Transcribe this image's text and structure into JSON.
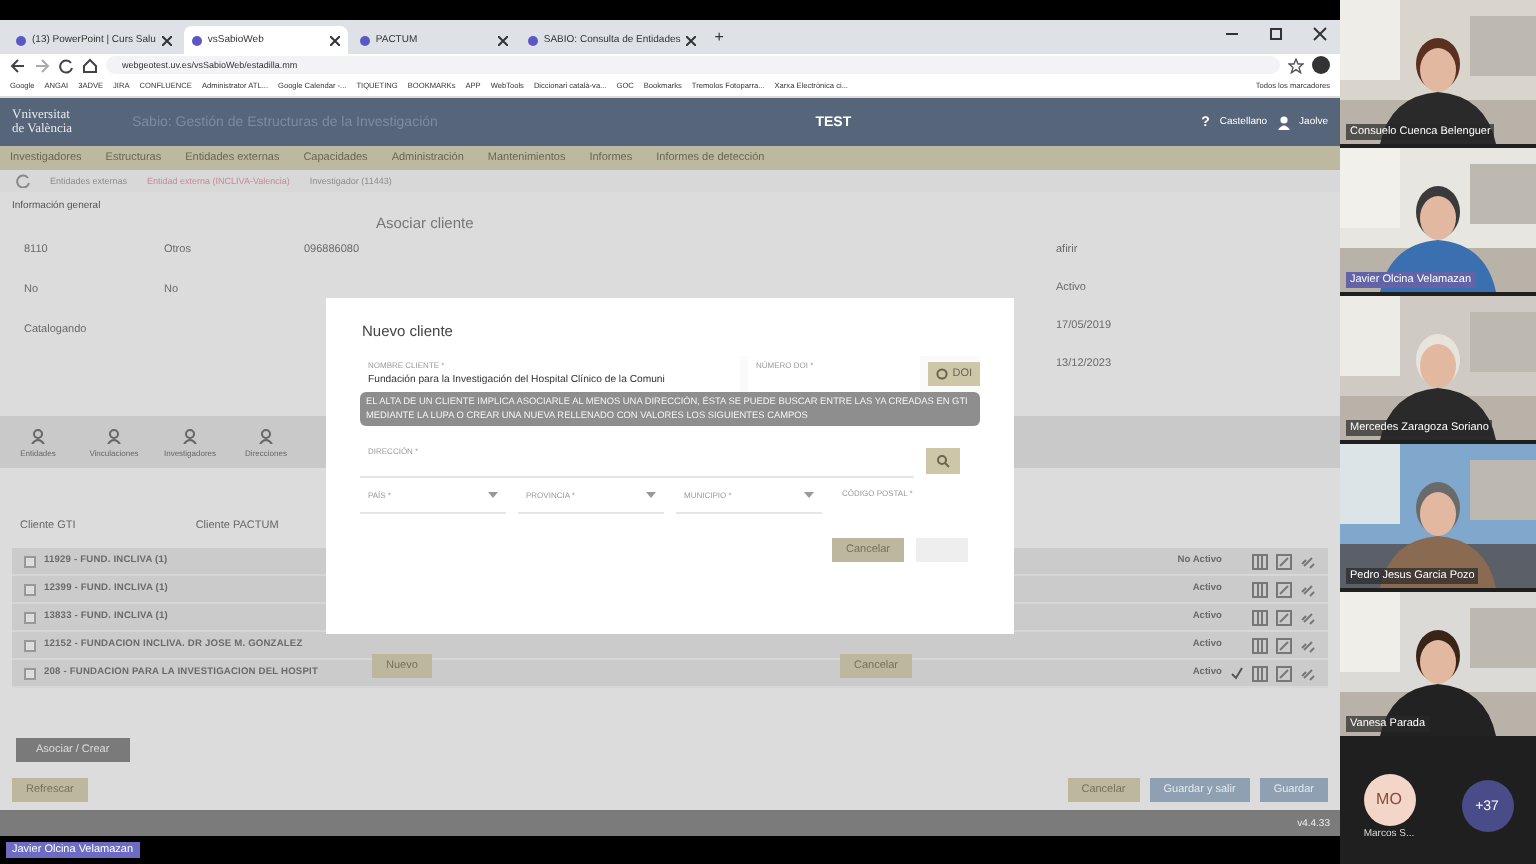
{
  "browser": {
    "tabs": [
      {
        "title": "(13) PowerPoint | Curs Salu",
        "selected": false
      },
      {
        "title": "vsSabioWeb",
        "selected": true
      },
      {
        "title": "PACTUM",
        "selected": false
      },
      {
        "title": "SABIO: Consulta de Entidades",
        "selected": false
      }
    ],
    "new_tab": "+",
    "url": "webgeotest.uv.es/vsSabioWeb/estadilla.mm",
    "bookmarks": [
      "Google",
      "ANGAI",
      "3ADVE",
      "JIRA",
      "CONFLUENCE",
      "Administrator ATL...",
      "Google Calendar -...",
      "TIQUETING",
      "BOOKMARKs",
      "APP",
      "WebTools",
      "Diccionari català-va...",
      "GOC",
      "Bookmarks",
      "Tremolos Fotoparra...",
      "Xarxa Electrònica ci..."
    ],
    "all_bookmarks": "Todos los marcadores"
  },
  "app": {
    "logo": [
      "Vniversitat",
      "de València"
    ],
    "subtitle": "Sabio: Gestión de Estructuras de la Investigación",
    "env": "TEST",
    "help": "?",
    "language": "Castellano",
    "user": "Jaolve",
    "menu": [
      "Investigadores",
      "Estructuras",
      "Entidades externas",
      "Capacidades",
      "Administración",
      "Mantenimientos",
      "Informes",
      "Informes de detección"
    ],
    "breadcrumbs": [
      "Entidades externas",
      "Entidad externa (INCLIVA-Valencia)",
      "Investigador (11443)"
    ]
  },
  "section_title": "Información general",
  "left_rows": [
    [
      "8110",
      "Otros",
      "096886080"
    ],
    [
      "No",
      "No"
    ],
    [
      "Catalogando"
    ]
  ],
  "right_values": [
    "afirir",
    "Activo",
    "17/05/2019",
    "13/12/2023"
  ],
  "detail_tabs": [
    "Entidades",
    "Vinculaciones",
    "Investigadores",
    "Direcciones"
  ],
  "table": {
    "columns": [
      "Cliente GTI",
      "Cliente PACTUM"
    ],
    "rows": [
      {
        "name": "11929 - FUND. INCLIVA (1)",
        "status": "No Activo",
        "verified": false,
        "checked": false
      },
      {
        "name": "12399 - FUND. INCLIVA (1)",
        "status": "Activo",
        "verified": false,
        "checked": false
      },
      {
        "name": "13833 - FUND. INCLIVA (1)",
        "status": "Activo",
        "verified": false,
        "checked": false
      },
      {
        "name": "12152 - FUNDACION INCLIVA. DR JOSE M. GONZALEZ",
        "status": "Activo",
        "verified": false,
        "checked": false
      },
      {
        "name": "208 - FUNDACION PARA LA INVESTIGACION DEL HOSPIT",
        "status": "Activo",
        "verified": true,
        "checked": false
      }
    ]
  },
  "dialog_behind": {
    "title": "Asociar cliente",
    "buttons": [
      "Nuevo",
      "Cancelar"
    ]
  },
  "modal": {
    "title": "Nuevo cliente",
    "name_label": "NOMBRE CLIENTE *",
    "name_value": "Fundación para la Investigación del Hospital Clínico de la Comuni",
    "doi_label": "NÚMERO DOI *",
    "doi_button": "DOI",
    "notice": "EL ALTA DE UN CLIENTE IMPLICA ASOCIARLE AL MENOS UNA DIRECCIÓN, ÉSTA SE PUEDE BUSCAR ENTRE LAS YA CREADAS EN GTI MEDIANTE LA LUPA O CREAR UNA NUEVA RELLENADO CON VALORES LOS SIGUIENTES CAMPOS",
    "address_label": "DIRECCIÓN *",
    "selects": [
      "PAÍS *",
      "PROVINCIA *",
      "MUNICIPIO *"
    ],
    "postal_label": "CÓDIGO POSTAL *",
    "cancel": "Cancelar"
  },
  "actions": {
    "associate": "Asociar / Crear",
    "refresh": "Refrescar",
    "buttons": [
      "Cancelar",
      "Guardar y salir",
      "Guardar"
    ],
    "version": "v4.4.33"
  },
  "meeting": {
    "participants": [
      {
        "name": "Consuelo Cuenca Belenguer",
        "highlighted": false
      },
      {
        "name": "Javier Olcina Velamazan",
        "highlighted": true
      },
      {
        "name": "Mercedes Zaragoza Soriano",
        "highlighted": false
      },
      {
        "name": "Pedro Jesus Garcia Pozo",
        "highlighted": false
      },
      {
        "name": "Vanesa Parada",
        "highlighted": false
      }
    ],
    "avatar": {
      "initials": "MO",
      "name": "Marcos S..."
    },
    "more": "+37",
    "speaker": "Javier Olcina Velamazan"
  }
}
